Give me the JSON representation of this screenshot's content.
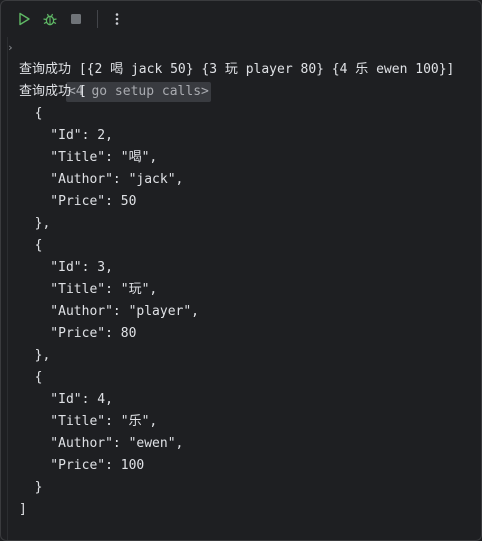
{
  "toolbar": {
    "run_icon": "play-icon",
    "debug_icon": "bug-icon",
    "stop_icon": "stop-icon",
    "more_icon": "more-vertical-icon",
    "run_color": "#5fb865",
    "debug_color": "#5fb865",
    "stop_color": "#6f7378"
  },
  "console": {
    "prompt_symbol": "›",
    "setup_text": "<4 go setup calls>",
    "lines": [
      "查询成功 [{2 喝 jack 50} {3 玩 player 80} {4 乐 ewen 100}]",
      "查询成功 [",
      "  {",
      "    \"Id\": 2,",
      "    \"Title\": \"喝\",",
      "    \"Author\": \"jack\",",
      "    \"Price\": 50",
      "  },",
      "  {",
      "    \"Id\": 3,",
      "    \"Title\": \"玩\",",
      "    \"Author\": \"player\",",
      "    \"Price\": 80",
      "  },",
      "  {",
      "    \"Id\": 4,",
      "    \"Title\": \"乐\",",
      "    \"Author\": \"ewen\",",
      "    \"Price\": 100",
      "  }",
      "]"
    ]
  }
}
